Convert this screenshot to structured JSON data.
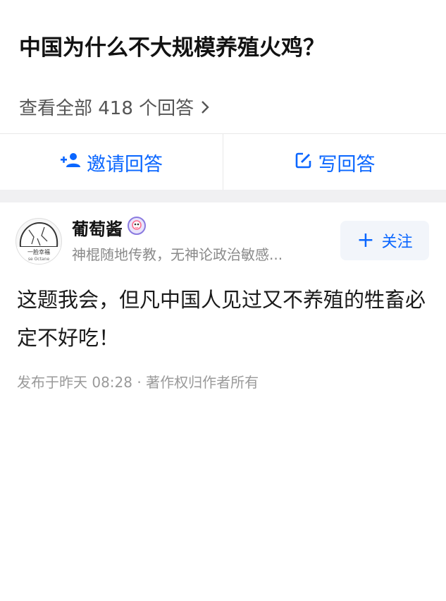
{
  "question": {
    "title": "中国为什么不大规模养殖火鸡？",
    "view_all": "查看全部 418 个回答"
  },
  "actions": {
    "invite_label": "邀请回答",
    "write_label": "写回答"
  },
  "answer": {
    "author_name": "葡萄酱",
    "author_bio": "神棍随地传教，无神论政治敏感...",
    "avatar_caption": "一脸幸福",
    "follow_label": "关注",
    "content": "这题我会，但凡中国人见过又不养殖的牲畜必定不好吃！",
    "meta": "发布于昨天 08:28 · 著作权归作者所有"
  },
  "colors": {
    "accent": "#0a66ff",
    "band": "#f0f0f2",
    "muted": "#9a9a9a"
  },
  "icons": [
    "add-person-icon",
    "edit-icon",
    "chevron-right-icon",
    "plus-icon",
    "verified-badge-icon"
  ]
}
